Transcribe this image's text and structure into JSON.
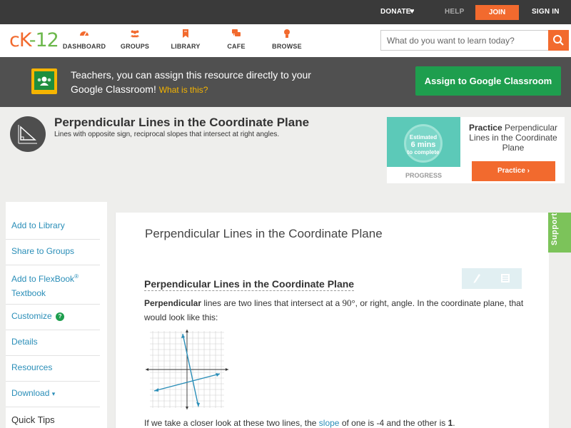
{
  "topbar": {
    "donate": "DONATE",
    "help": "HELP",
    "join": "JOIN",
    "signin": "SIGN IN"
  },
  "nav": {
    "logo": {
      "c": "c",
      "k": "K",
      "n": "-12"
    },
    "items": [
      {
        "label": "DASHBOARD",
        "icon": "dashboard-icon"
      },
      {
        "label": "GROUPS",
        "icon": "groups-icon"
      },
      {
        "label": "LIBRARY",
        "icon": "library-icon"
      },
      {
        "label": "CAFE",
        "icon": "cafe-icon"
      },
      {
        "label": "BROWSE",
        "icon": "browse-icon"
      }
    ],
    "search_placeholder": "What do you want to learn today?"
  },
  "banner": {
    "text": "Teachers, you can assign this resource directly to your Google Classroom!",
    "what_is_this": "What is this?",
    "assign_button": "Assign to Google Classroom"
  },
  "header": {
    "title": "Perpendicular Lines in the Coordinate Plane",
    "subtitle": "Lines with opposite sign, reciprocal slopes that intersect at right angles."
  },
  "practice_card": {
    "estimated": "Estimated",
    "mins": "6 mins",
    "to_complete": "to complete",
    "progress_label": "PROGRESS",
    "title_bold": "Practice",
    "title_rest": " Perpendicular Lines in the Coordinate Plane",
    "button": "Practice"
  },
  "sidebar": {
    "add_to_library": "Add to Library",
    "share_to_groups": "Share to Groups",
    "add_to_flexbook_1": "Add to FlexBook",
    "add_to_flexbook_reg": "®",
    "add_to_flexbook_2": "Textbook",
    "customize": "Customize",
    "customize_help": "?",
    "details": "Details",
    "resources": "Resources",
    "download": "Download",
    "download_caret": "▾",
    "quick_tips": "Quick Tips"
  },
  "content": {
    "title": "Perpendicular Lines in the Coordinate Plane",
    "section_title": "Perpendicular Lines in the Coordinate Plane",
    "para_bold": "Perpendicular",
    "para_text_1": " lines are two lines that intersect at a ",
    "para_math": "90°",
    "para_text_2": ", or right, angle. In the coordinate plane, that would look like this:",
    "para2_text_1": "If we take a closer look at these two lines, the ",
    "para2_link": "slope",
    "para2_text_2": " of one is -4 and the other is ",
    "para2_frac": "1",
    "para2_end": "."
  },
  "support": "Support",
  "colors": {
    "accent_orange": "#f26a2e",
    "google_green": "#1e9e4e",
    "link_blue": "#2a8eb8",
    "teal": "#5cc9b8"
  }
}
